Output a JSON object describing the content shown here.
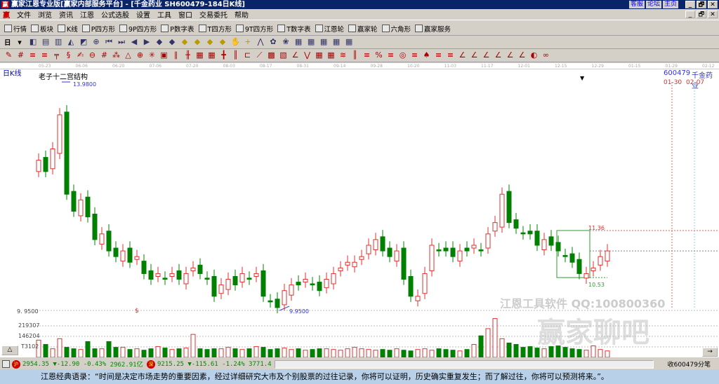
{
  "window": {
    "title": "赢家江恩专业版[赢家内部服务平台] - [千金药业   SH600479-184日K线]",
    "links": [
      "客服",
      "论坛",
      "主页"
    ],
    "buttons": [
      "_",
      "🗗",
      "✕"
    ]
  },
  "menu": [
    "文件",
    "浏览",
    "资讯",
    "江恩",
    "公式选股",
    "设置",
    "工具",
    "窗口",
    "交易委托",
    "帮助"
  ],
  "toolbar1": [
    {
      "label": "行情",
      "icon": "quote-icon"
    },
    {
      "label": "板块",
      "icon": "sector-icon"
    },
    {
      "label": "K线",
      "icon": "kline-icon"
    },
    {
      "label": "P四方形",
      "icon": "P4-icon"
    },
    {
      "label": "9P四方形",
      "icon": "9P-icon"
    },
    {
      "label": "P数字表",
      "icon": "PN-icon"
    },
    {
      "label": "T四方形",
      "icon": "TS-icon"
    },
    {
      "label": "9T四方形",
      "icon": "T9-icon"
    },
    {
      "label": "T数字表",
      "icon": "TN-icon"
    },
    {
      "label": "江恩轮",
      "icon": "gann-wheel-icon"
    },
    {
      "label": "赢家轮",
      "icon": "winner-wheel-icon"
    },
    {
      "label": "六角形",
      "icon": "hexagon-icon"
    },
    {
      "label": "赢家服务",
      "icon": "dollar-icon"
    }
  ],
  "toolbar2": {
    "period": "日"
  },
  "chart": {
    "panel_label": "日K线",
    "indicator": "老子十二宫结构",
    "stock_code": "600479",
    "stock_name": "千金药业",
    "future_dates": [
      "01-30",
      "02-07"
    ],
    "dates": [
      "05-23",
      "06-06",
      "06-20",
      "07-06",
      "07-20",
      "08-03",
      "08-17",
      "08-31",
      "09-14",
      "09-28",
      "10-20",
      "11-03",
      "11-17",
      "12-01",
      "12-15",
      "12-29",
      "01-15",
      "01-29",
      "02-12"
    ],
    "high_label": "13.9800",
    "low_label": "9.9500",
    "axis_low": "9. 9500",
    "box_high": "11.36",
    "box_low": "10.53",
    "volume_ticks": [
      "219307",
      "146204",
      "T3102"
    ],
    "colors": {
      "up": "#e03030",
      "down": "#008000"
    },
    "closes": [
      12.6,
      12.4,
      12.8,
      13.4,
      12.0,
      11.7,
      11.9,
      11.6,
      11.2,
      11.3,
      11.0,
      10.9,
      11.0,
      10.8,
      10.9,
      10.6,
      10.5,
      10.6,
      10.5,
      10.6,
      10.5,
      10.6,
      10.7,
      10.6,
      10.5,
      10.2,
      10.4,
      10.5,
      10.4,
      10.6,
      10.5,
      10.6,
      10.2,
      10.1,
      10.0,
      10.3,
      10.4,
      10.4,
      10.5,
      10.4,
      10.3,
      10.5,
      10.6,
      10.7,
      10.8,
      10.8,
      10.9,
      11.1,
      11.2,
      11.0,
      10.9,
      11.0,
      10.5,
      10.2,
      10.2,
      10.6,
      11.1,
      11.0,
      11.0,
      10.9,
      11.0,
      11.0,
      11.1,
      11.0,
      11.3,
      11.5,
      12.0,
      11.5,
      11.4,
      11.3,
      11.3,
      11.1,
      11.2,
      11.1,
      11.0,
      10.9,
      10.8,
      10.6,
      10.6,
      10.7,
      10.9,
      11.0
    ],
    "volumes": [
      120000,
      90000,
      60000,
      130000,
      70000,
      60000,
      55000,
      110000,
      60000,
      60000,
      110000,
      70000,
      70000,
      55000,
      60000,
      50000,
      60000,
      75000,
      65000,
      55000,
      60000,
      65000,
      160000,
      60000,
      55000,
      60000,
      60000,
      70000,
      60000,
      55000,
      60000,
      75000,
      70000,
      55000,
      60000,
      65000,
      55000,
      60000,
      50000,
      55000,
      60000,
      60000,
      55000,
      50000,
      60000,
      70000,
      60000,
      55000,
      50000,
      55000,
      50000,
      60000,
      50000,
      45000,
      55000,
      60000,
      50000,
      60000,
      55000,
      50000,
      45000,
      55000,
      90000,
      150000,
      200000,
      270000,
      130000,
      100000,
      90000,
      70000,
      75000,
      65000,
      60000,
      75000,
      80000,
      70000,
      60000,
      55000,
      50000,
      80000,
      55000,
      45000
    ]
  },
  "status": {
    "sh_index": "2954.35",
    "sh_change": "▼-12.90",
    "sh_pct": "-0.43%",
    "sh_amount": "2962.91亿",
    "sz_index": "9215.25",
    "sz_change": "▼-115.61",
    "sz_pct": "-1.24%",
    "sz_amount": "3771.4",
    "tick_label": "收600479分笔",
    "sh_badge": "沪",
    "sz_badge": "深"
  },
  "watermark": {
    "line1": "江恩工具软件  QQ:100800360",
    "line2": "赢家聊吧"
  },
  "quote": "江恩经典语录：“时间是决定市场走势的重要因素，经过详细研究大市及个别股票的过往记录，你将可以证明，历史确实重复发生；而了解过往，你将可以预测将来。”。"
}
